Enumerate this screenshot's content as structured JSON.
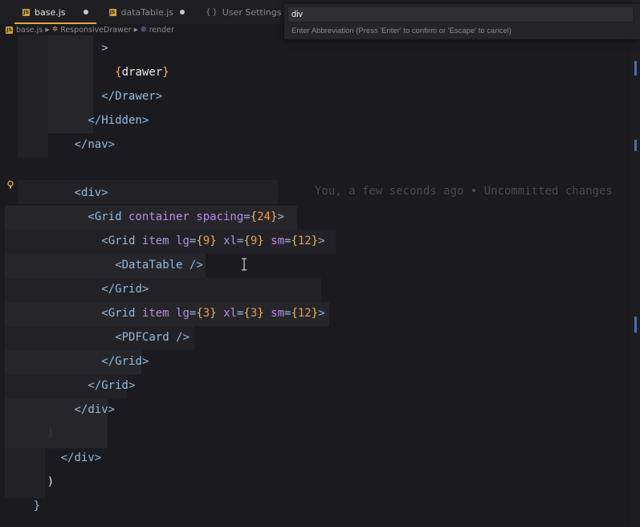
{
  "tabs": [
    {
      "label": "base.js",
      "icon": "js-file-icon",
      "active": true,
      "modified": true
    },
    {
      "label": "dataTable.js",
      "icon": "js-file-icon",
      "active": false,
      "modified": true
    },
    {
      "label": "User Settings",
      "icon": "settings-braces-icon",
      "active": false,
      "modified": false
    }
  ],
  "breadcrumb": {
    "file": "base.js",
    "component": "ResponsiveDrawer",
    "method": "render"
  },
  "palette": {
    "input_value": "div",
    "hint": "Enter Abbreviation (Press 'Enter' to confirm or 'Escape' to cancel)"
  },
  "blame": "You, a few seconds ago • Uncommitted changes",
  "code": [
    {
      "indent": 14,
      "tokens": [
        [
          "b",
          ">"
        ]
      ]
    },
    {
      "indent": 16,
      "tokens": [
        [
          "br",
          "{"
        ],
        [
          "x",
          "drawer"
        ],
        [
          "br",
          "}"
        ]
      ]
    },
    {
      "indent": 14,
      "tokens": [
        [
          "b",
          "</"
        ],
        [
          "t",
          "Drawer"
        ],
        [
          "b",
          ">"
        ]
      ]
    },
    {
      "indent": 12,
      "tokens": [
        [
          "b",
          "</"
        ],
        [
          "t",
          "Hidden"
        ],
        [
          "b",
          ">"
        ]
      ]
    },
    {
      "indent": 10,
      "tokens": [
        [
          "b",
          "</"
        ],
        [
          "t",
          "nav"
        ],
        [
          "b",
          ">"
        ]
      ]
    },
    {
      "indent": 0,
      "tokens": []
    },
    {
      "indent": 10,
      "tokens": [
        [
          "b",
          "<"
        ],
        [
          "t",
          "div"
        ],
        [
          "b",
          ">"
        ]
      ]
    },
    {
      "indent": 12,
      "tokens": [
        [
          "b",
          "<"
        ],
        [
          "t",
          "Grid"
        ],
        [
          "x",
          " "
        ],
        [
          "a",
          "container"
        ],
        [
          "x",
          " "
        ],
        [
          "a",
          "spacing"
        ],
        [
          "b",
          "="
        ],
        [
          "br",
          "{"
        ],
        [
          "n",
          "24"
        ],
        [
          "br",
          "}"
        ],
        [
          "b",
          ">"
        ]
      ]
    },
    {
      "indent": 14,
      "tokens": [
        [
          "b",
          "<"
        ],
        [
          "t",
          "Grid"
        ],
        [
          "x",
          " "
        ],
        [
          "a",
          "item"
        ],
        [
          "x",
          " "
        ],
        [
          "a",
          "lg"
        ],
        [
          "b",
          "="
        ],
        [
          "br",
          "{"
        ],
        [
          "n",
          "9"
        ],
        [
          "br",
          "}"
        ],
        [
          "x",
          " "
        ],
        [
          "a",
          "xl"
        ],
        [
          "b",
          "="
        ],
        [
          "br",
          "{"
        ],
        [
          "n",
          "9"
        ],
        [
          "br",
          "}"
        ],
        [
          "x",
          " "
        ],
        [
          "a",
          "sm"
        ],
        [
          "b",
          "="
        ],
        [
          "br",
          "{"
        ],
        [
          "n",
          "12"
        ],
        [
          "br",
          "}"
        ],
        [
          "b",
          ">"
        ]
      ]
    },
    {
      "indent": 16,
      "tokens": [
        [
          "b",
          "<"
        ],
        [
          "t",
          "DataTable"
        ],
        [
          "x",
          " "
        ],
        [
          "b",
          "/>"
        ]
      ]
    },
    {
      "indent": 14,
      "tokens": [
        [
          "b",
          "</"
        ],
        [
          "t",
          "Grid"
        ],
        [
          "b",
          ">"
        ]
      ]
    },
    {
      "indent": 14,
      "tokens": [
        [
          "b",
          "<"
        ],
        [
          "t",
          "Grid"
        ],
        [
          "x",
          " "
        ],
        [
          "a",
          "item"
        ],
        [
          "x",
          " "
        ],
        [
          "a",
          "lg"
        ],
        [
          "b",
          "="
        ],
        [
          "br",
          "{"
        ],
        [
          "n",
          "3"
        ],
        [
          "br",
          "}"
        ],
        [
          "x",
          " "
        ],
        [
          "a",
          "xl"
        ],
        [
          "b",
          "="
        ],
        [
          "br",
          "{"
        ],
        [
          "n",
          "3"
        ],
        [
          "br",
          "}"
        ],
        [
          "x",
          " "
        ],
        [
          "a",
          "sm"
        ],
        [
          "b",
          "="
        ],
        [
          "br",
          "{"
        ],
        [
          "n",
          "12"
        ],
        [
          "br",
          "}"
        ],
        [
          "b",
          ">"
        ]
      ]
    },
    {
      "indent": 16,
      "tokens": [
        [
          "b",
          "<"
        ],
        [
          "t",
          "PDFCard"
        ],
        [
          "x",
          " "
        ],
        [
          "b",
          "/>"
        ]
      ]
    },
    {
      "indent": 14,
      "tokens": [
        [
          "b",
          "</"
        ],
        [
          "t",
          "Grid"
        ],
        [
          "b",
          ">"
        ]
      ]
    },
    {
      "indent": 12,
      "tokens": [
        [
          "b",
          "</"
        ],
        [
          "t",
          "Grid"
        ],
        [
          "b",
          ">"
        ]
      ]
    },
    {
      "indent": 10,
      "tokens": [
        [
          "b",
          "</"
        ],
        [
          "t",
          "div"
        ],
        [
          "b",
          ">"
        ]
      ]
    },
    {
      "indent": 6,
      "tokens": [
        [
          "d",
          ")"
        ]
      ]
    },
    {
      "indent": 8,
      "tokens": [
        [
          "b",
          "</"
        ],
        [
          "t",
          "div"
        ],
        [
          "b",
          ">"
        ]
      ]
    },
    {
      "indent": 6,
      "tokens": [
        [
          "x",
          ")"
        ]
      ]
    },
    {
      "indent": 4,
      "tokens": [
        [
          "b",
          "}"
        ]
      ]
    }
  ],
  "colors": {
    "accent": "#e5a93a",
    "tag": "#8fbbe0",
    "attribute": "#b98be7",
    "number": "#ef9a50",
    "brace": "#e8b65b"
  }
}
